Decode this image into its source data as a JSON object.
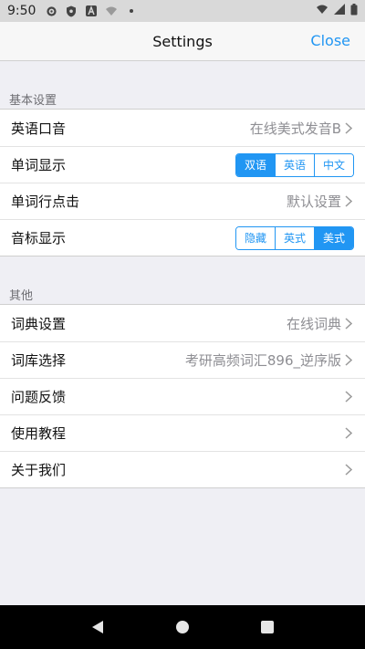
{
  "statusbar": {
    "time": "9:50"
  },
  "nav": {
    "title": "Settings",
    "close_label": "Close"
  },
  "sections": [
    {
      "header": "基本设置",
      "rows": [
        {
          "label": "英语口音",
          "value": "在线美式发音B"
        },
        {
          "label": "单词显示",
          "options": [
            "双语",
            "英语",
            "中文"
          ],
          "selected": "双语"
        },
        {
          "label": "单词行点击",
          "value": "默认设置"
        },
        {
          "label": "音标显示",
          "options": [
            "隐藏",
            "英式",
            "美式"
          ],
          "selected": "美式"
        }
      ]
    },
    {
      "header": "其他",
      "rows": [
        {
          "label": "词典设置",
          "value": "在线词典"
        },
        {
          "label": "词库选择",
          "value": "考研高频词汇896_逆序版"
        },
        {
          "label": "问题反馈"
        },
        {
          "label": "使用教程"
        },
        {
          "label": "关于我们"
        }
      ]
    }
  ],
  "colors": {
    "accent": "#2196f3",
    "background": "#efeff4"
  },
  "icons": [
    "settings-status-icon",
    "shield-status-icon",
    "a-status-icon",
    "wifi-icon",
    "signal-icon",
    "battery-icon",
    "chevron-right-icon",
    "back-icon",
    "home-icon",
    "recents-icon"
  ]
}
